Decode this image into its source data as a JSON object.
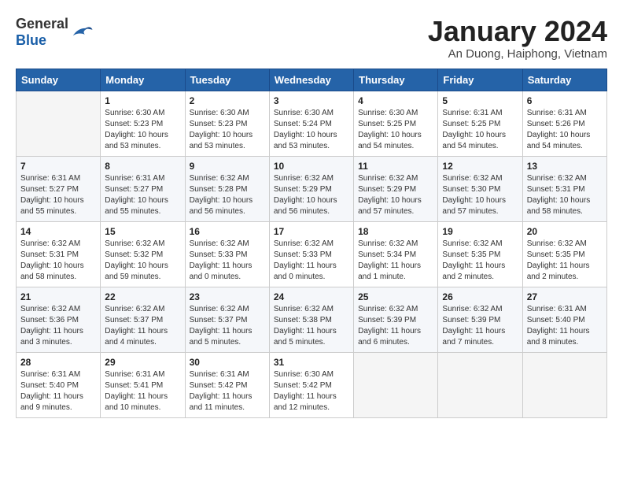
{
  "header": {
    "logo_general": "General",
    "logo_blue": "Blue",
    "month_title": "January 2024",
    "subtitle": "An Duong, Haiphong, Vietnam"
  },
  "weekdays": [
    "Sunday",
    "Monday",
    "Tuesday",
    "Wednesday",
    "Thursday",
    "Friday",
    "Saturday"
  ],
  "weeks": [
    [
      {
        "day": "",
        "info": ""
      },
      {
        "day": "1",
        "info": "Sunrise: 6:30 AM\nSunset: 5:23 PM\nDaylight: 10 hours\nand 53 minutes."
      },
      {
        "day": "2",
        "info": "Sunrise: 6:30 AM\nSunset: 5:23 PM\nDaylight: 10 hours\nand 53 minutes."
      },
      {
        "day": "3",
        "info": "Sunrise: 6:30 AM\nSunset: 5:24 PM\nDaylight: 10 hours\nand 53 minutes."
      },
      {
        "day": "4",
        "info": "Sunrise: 6:30 AM\nSunset: 5:25 PM\nDaylight: 10 hours\nand 54 minutes."
      },
      {
        "day": "5",
        "info": "Sunrise: 6:31 AM\nSunset: 5:25 PM\nDaylight: 10 hours\nand 54 minutes."
      },
      {
        "day": "6",
        "info": "Sunrise: 6:31 AM\nSunset: 5:26 PM\nDaylight: 10 hours\nand 54 minutes."
      }
    ],
    [
      {
        "day": "7",
        "info": "Sunrise: 6:31 AM\nSunset: 5:27 PM\nDaylight: 10 hours\nand 55 minutes."
      },
      {
        "day": "8",
        "info": "Sunrise: 6:31 AM\nSunset: 5:27 PM\nDaylight: 10 hours\nand 55 minutes."
      },
      {
        "day": "9",
        "info": "Sunrise: 6:32 AM\nSunset: 5:28 PM\nDaylight: 10 hours\nand 56 minutes."
      },
      {
        "day": "10",
        "info": "Sunrise: 6:32 AM\nSunset: 5:29 PM\nDaylight: 10 hours\nand 56 minutes."
      },
      {
        "day": "11",
        "info": "Sunrise: 6:32 AM\nSunset: 5:29 PM\nDaylight: 10 hours\nand 57 minutes."
      },
      {
        "day": "12",
        "info": "Sunrise: 6:32 AM\nSunset: 5:30 PM\nDaylight: 10 hours\nand 57 minutes."
      },
      {
        "day": "13",
        "info": "Sunrise: 6:32 AM\nSunset: 5:31 PM\nDaylight: 10 hours\nand 58 minutes."
      }
    ],
    [
      {
        "day": "14",
        "info": "Sunrise: 6:32 AM\nSunset: 5:31 PM\nDaylight: 10 hours\nand 58 minutes."
      },
      {
        "day": "15",
        "info": "Sunrise: 6:32 AM\nSunset: 5:32 PM\nDaylight: 10 hours\nand 59 minutes."
      },
      {
        "day": "16",
        "info": "Sunrise: 6:32 AM\nSunset: 5:33 PM\nDaylight: 11 hours\nand 0 minutes."
      },
      {
        "day": "17",
        "info": "Sunrise: 6:32 AM\nSunset: 5:33 PM\nDaylight: 11 hours\nand 0 minutes."
      },
      {
        "day": "18",
        "info": "Sunrise: 6:32 AM\nSunset: 5:34 PM\nDaylight: 11 hours\nand 1 minute."
      },
      {
        "day": "19",
        "info": "Sunrise: 6:32 AM\nSunset: 5:35 PM\nDaylight: 11 hours\nand 2 minutes."
      },
      {
        "day": "20",
        "info": "Sunrise: 6:32 AM\nSunset: 5:35 PM\nDaylight: 11 hours\nand 2 minutes."
      }
    ],
    [
      {
        "day": "21",
        "info": "Sunrise: 6:32 AM\nSunset: 5:36 PM\nDaylight: 11 hours\nand 3 minutes."
      },
      {
        "day": "22",
        "info": "Sunrise: 6:32 AM\nSunset: 5:37 PM\nDaylight: 11 hours\nand 4 minutes."
      },
      {
        "day": "23",
        "info": "Sunrise: 6:32 AM\nSunset: 5:37 PM\nDaylight: 11 hours\nand 5 minutes."
      },
      {
        "day": "24",
        "info": "Sunrise: 6:32 AM\nSunset: 5:38 PM\nDaylight: 11 hours\nand 5 minutes."
      },
      {
        "day": "25",
        "info": "Sunrise: 6:32 AM\nSunset: 5:39 PM\nDaylight: 11 hours\nand 6 minutes."
      },
      {
        "day": "26",
        "info": "Sunrise: 6:32 AM\nSunset: 5:39 PM\nDaylight: 11 hours\nand 7 minutes."
      },
      {
        "day": "27",
        "info": "Sunrise: 6:31 AM\nSunset: 5:40 PM\nDaylight: 11 hours\nand 8 minutes."
      }
    ],
    [
      {
        "day": "28",
        "info": "Sunrise: 6:31 AM\nSunset: 5:40 PM\nDaylight: 11 hours\nand 9 minutes."
      },
      {
        "day": "29",
        "info": "Sunrise: 6:31 AM\nSunset: 5:41 PM\nDaylight: 11 hours\nand 10 minutes."
      },
      {
        "day": "30",
        "info": "Sunrise: 6:31 AM\nSunset: 5:42 PM\nDaylight: 11 hours\nand 11 minutes."
      },
      {
        "day": "31",
        "info": "Sunrise: 6:30 AM\nSunset: 5:42 PM\nDaylight: 11 hours\nand 12 minutes."
      },
      {
        "day": "",
        "info": ""
      },
      {
        "day": "",
        "info": ""
      },
      {
        "day": "",
        "info": ""
      }
    ]
  ]
}
